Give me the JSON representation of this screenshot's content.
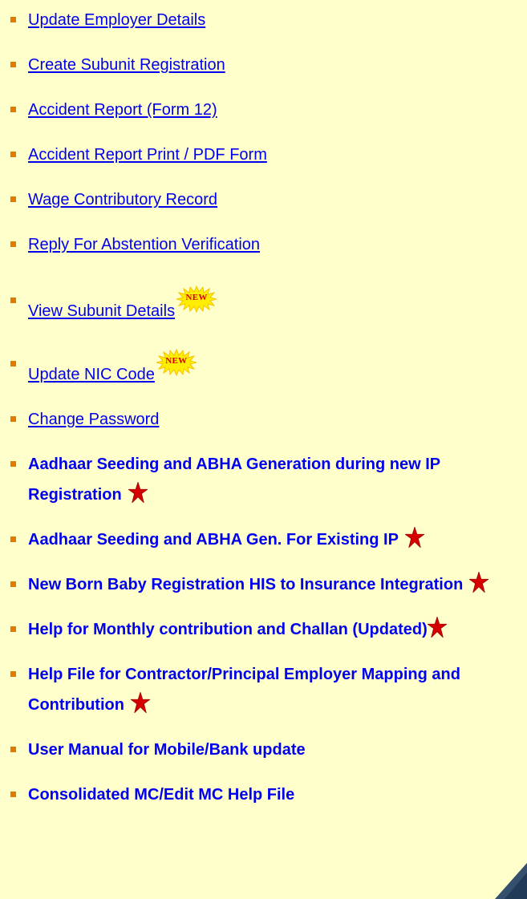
{
  "menu": {
    "items": [
      {
        "label": "Update Employer Details",
        "bold": false
      },
      {
        "label": "Create Subunit Registration",
        "bold": false
      },
      {
        "label": "Accident Report (Form 12)",
        "bold": false
      },
      {
        "label": "Accident Report Print / PDF Form",
        "bold": false
      },
      {
        "label": "Wage Contributory Record",
        "bold": false
      },
      {
        "label": "Reply For Abstention Verification",
        "bold": false
      },
      {
        "label": "View Subunit Details",
        "bold": false,
        "badge": "NEW"
      },
      {
        "label": "Update NIC Code",
        "bold": false,
        "badge": "NEW"
      },
      {
        "label": "Change Password",
        "bold": false
      },
      {
        "label": "Aadhaar Seeding and ABHA Generation during new IP Registration",
        "bold": true,
        "icon": "red-star-icon"
      },
      {
        "label": "Aadhaar Seeding and ABHA Gen. For Existing IP",
        "bold": true,
        "icon": "red-star-icon"
      },
      {
        "label": "New Born Baby Registration HIS to Insurance Integration",
        "bold": true,
        "icon": "red-star-icon"
      },
      {
        "label": "Help for Monthly contribution and Challan (Updated)",
        "bold": true,
        "icon": "red-star-icon"
      },
      {
        "label": "Help File for Contractor/Principal Employer Mapping and Contribution",
        "bold": true,
        "icon": "red-star-icon"
      },
      {
        "label": "User Manual for Mobile/Bank update",
        "bold": true
      },
      {
        "label": "Consolidated MC/Edit MC Help File",
        "bold": true
      }
    ]
  },
  "colors": {
    "background": "#ffffcc",
    "link": "#0000ee",
    "bullet": "#e07b00",
    "star": "#d40000",
    "badge_fill": "#ffee00",
    "badge_text": "#d40000"
  }
}
